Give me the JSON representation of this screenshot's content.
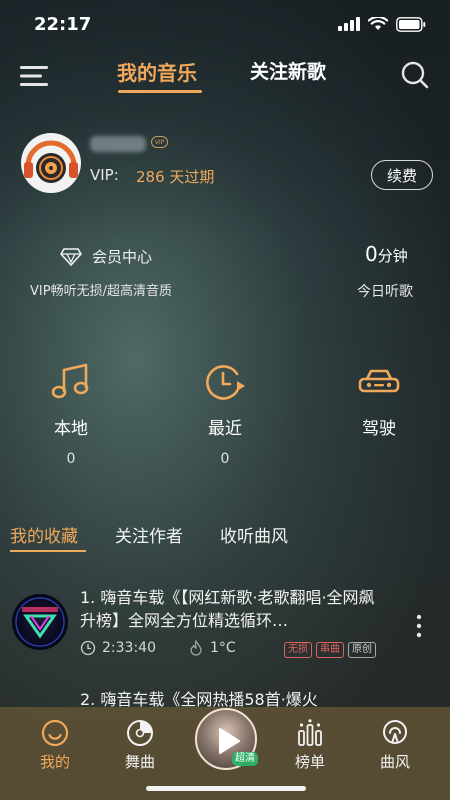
{
  "status": {
    "time": "22:17"
  },
  "nav": {
    "tabs": [
      {
        "label": "我的音乐",
        "active": true
      },
      {
        "label": "关注新歌",
        "active": false
      }
    ]
  },
  "profile": {
    "vip_tag": "VIP",
    "vip_label": "VIP:",
    "vip_days": "286 天过期",
    "renew_label": "续费"
  },
  "member": {
    "title": "会员中心",
    "subtitle": "VIP畅听无损/超高清音质",
    "minutes_value": "0",
    "minutes_unit": "分钟",
    "minutes_label": "今日听歌"
  },
  "quick_actions": [
    {
      "label": "本地",
      "count": "0",
      "icon": "music-note-icon"
    },
    {
      "label": "最近",
      "count": "0",
      "icon": "clock-play-icon"
    },
    {
      "label": "驾驶",
      "count": "",
      "icon": "car-icon"
    }
  ],
  "sub_tabs": [
    {
      "label": "我的收藏",
      "active": true
    },
    {
      "label": "关注作者",
      "active": false
    },
    {
      "label": "收听曲风",
      "active": false
    }
  ],
  "songs": [
    {
      "title": "1. 嗨音车载《【网红新歌·老歌翻唱·全网飙升榜】全网全方位精选循环…",
      "duration": "2:33:40",
      "heat": "1°C",
      "tags": [
        "无损",
        "串曲",
        "原创"
      ]
    },
    {
      "title": "2. 嗨音车载《全网热播58首·爆火"
    }
  ],
  "bottom_nav": [
    {
      "label": "我的",
      "active": true,
      "icon": "smile-icon"
    },
    {
      "label": "舞曲",
      "active": false,
      "icon": "disc-icon"
    },
    {
      "label": "榜单",
      "active": false,
      "icon": "chart-icon"
    },
    {
      "label": "曲风",
      "active": false,
      "icon": "radar-icon"
    }
  ],
  "player": {
    "badge": "超清"
  },
  "colors": {
    "accent": "#f0a85a",
    "tag_red": "#e06060",
    "badge_green": "#2fae66"
  }
}
